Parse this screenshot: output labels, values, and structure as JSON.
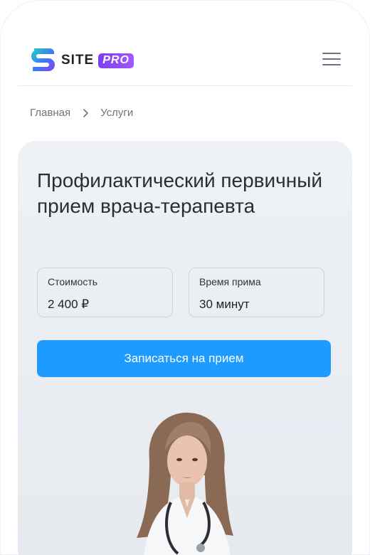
{
  "header": {
    "logo_text": "SITE",
    "logo_badge": "PRO"
  },
  "breadcrumb": {
    "items": [
      "Главная",
      "Услуги"
    ]
  },
  "service": {
    "title": "Профилактический первичный прием врача-терапевта",
    "price_label": "Стоимость",
    "price_value": "2 400 ₽",
    "time_label": "Время прима",
    "time_value": "30 минут",
    "cta_label": "Записаться на прием"
  },
  "colors": {
    "accent": "#1e9bff",
    "card_bg": "#eef2f6",
    "brand_gradient_start": "#20c4d8",
    "brand_gradient_end": "#7b3ff2"
  },
  "icons": {
    "logo": "site-logo-icon",
    "menu": "hamburger-icon",
    "breadcrumb_separator": "chevron-right-icon"
  }
}
